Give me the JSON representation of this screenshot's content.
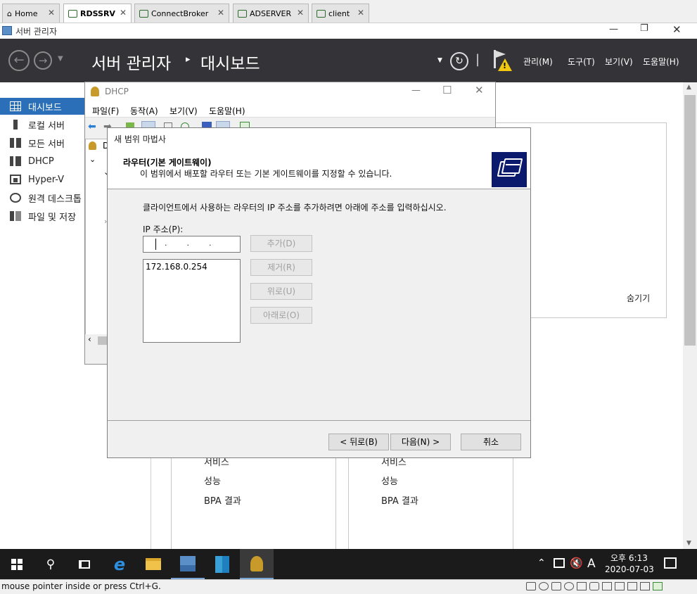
{
  "host_tabs": [
    {
      "label": "Home"
    },
    {
      "label": "RDSSRV"
    },
    {
      "label": "ConnectBroker"
    },
    {
      "label": "ADSERVER"
    },
    {
      "label": "client"
    }
  ],
  "server_manager": {
    "window_title": "서버 관리자",
    "breadcrumb_root": "서버 관리자",
    "breadcrumb_sep": "▸",
    "breadcrumb_page": "대시보드",
    "menu": [
      "관리(M)",
      "도구(T)",
      "보기(V)",
      "도움말(H)"
    ],
    "pipe": "|"
  },
  "sidebar": {
    "items": [
      {
        "label": "대시보드",
        "icon": "dashboard-icon"
      },
      {
        "label": "로컬 서버",
        "icon": "local-server-icon"
      },
      {
        "label": "모든 서버",
        "icon": "all-servers-icon"
      },
      {
        "label": "DHCP",
        "icon": "dhcp-icon"
      },
      {
        "label": "Hyper-V",
        "icon": "hyperv-icon"
      },
      {
        "label": "원격 데스크톱",
        "icon": "remote-desktop-icon"
      },
      {
        "label": "파일 및 저장",
        "icon": "file-storage-icon"
      }
    ]
  },
  "background": {
    "hide_label": "숨기기",
    "tile_left": [
      "서비스",
      "성능",
      "BPA 결과"
    ],
    "tile_right": [
      "서비스",
      "성능",
      "BPA 결과"
    ]
  },
  "dhcp_console": {
    "title": "DHCP",
    "menu": [
      "파일(F)",
      "동작(A)",
      "보기(V)",
      "도움말(H)"
    ],
    "tree_first": "D"
  },
  "wizard": {
    "title": "새 범위 마법사",
    "header_title": "라우터(기본 게이트웨이)",
    "header_desc": "이 범위에서 배포할 라우터 또는 기본 게이트웨이를 지정할 수 있습니다.",
    "instruction": "클라이언트에서 사용하는 라우터의 IP 주소를 추가하려면 아래에 주소를 입력하십시오.",
    "ip_label": "IP 주소(P):",
    "ip_dots": ".        .        .",
    "router_list": [
      "172.168.0.254"
    ],
    "buttons": {
      "add": "추가(D)",
      "remove": "제거(R)",
      "up": "위로(U)",
      "down": "아래로(O)"
    },
    "nav": {
      "back": "< 뒤로(B)",
      "next": "다음(N) >",
      "cancel": "취소"
    }
  },
  "taskbar": {
    "ime": "A",
    "time": "오후 6:13",
    "date": "2020-07-03"
  },
  "statusbar": {
    "message": "mouse pointer inside or press Ctrl+G."
  },
  "colors": {
    "accent": "#2b6fb8",
    "header_bg": "#333338",
    "taskbar_bg": "#1b1b1b",
    "warning": "#f2c811"
  }
}
